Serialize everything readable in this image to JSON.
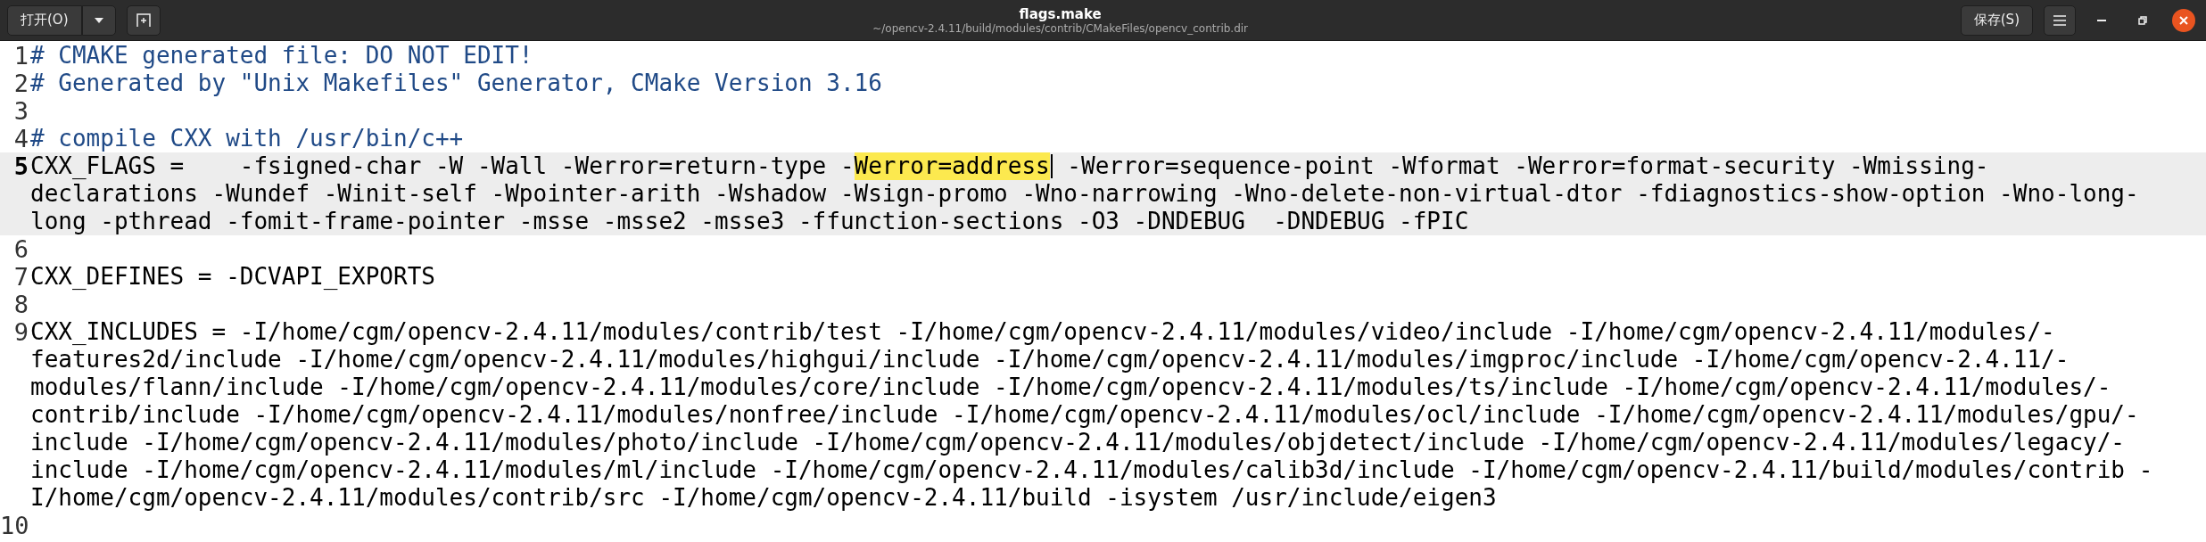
{
  "header": {
    "open_button": "打开(O)",
    "title": "flags.make",
    "subtitle": "~/opencv-2.4.11/build/modules/contrib/CMakeFiles/opencv_contrib.dir",
    "save_button": "保存(S)"
  },
  "lines": [
    {
      "number": "1",
      "kind": "comment",
      "current": false,
      "rows": [
        [
          {
            "text": "# CMAKE generated file: DO NOT EDIT!",
            "highlighted": false,
            "cursor": false
          }
        ]
      ]
    },
    {
      "number": "2",
      "kind": "comment",
      "current": false,
      "rows": [
        [
          {
            "text": "# Generated by \"Unix Makefiles\" Generator, CMake Version 3.16",
            "highlighted": false,
            "cursor": false
          }
        ]
      ]
    },
    {
      "number": "3",
      "current": false
    },
    {
      "number": "4",
      "kind": "comment",
      "current": false,
      "rows": [
        [
          {
            "text": "# compile CXX with /usr/bin/c++",
            "highlighted": false,
            "cursor": false
          }
        ]
      ]
    },
    {
      "number": "5",
      "kind": "plain",
      "current": true,
      "rows": [
        [
          {
            "text": "CXX_FLAGS =    -fsigned-char -W -Wall -Werror=return-type -",
            "highlighted": false,
            "cursor": false
          },
          {
            "text": "Werror=address",
            "highlighted": true,
            "cursor": true
          },
          {
            "text": " -Werror=sequence-point -Wformat -Werror=format-security -Wmissing-",
            "highlighted": false,
            "cursor": false
          }
        ],
        [
          {
            "text": "declarations -Wundef -Winit-self -Wpointer-arith -Wshadow -Wsign-promo -Wno-narrowing -Wno-delete-non-virtual-dtor -fdiagnostics-show-option -Wno-long-",
            "highlighted": false,
            "cursor": false
          }
        ],
        [
          {
            "text": "long -pthread -fomit-frame-pointer -msse -msse2 -msse3 -ffunction-sections -O3 -DNDEBUG  -DNDEBUG -fPIC",
            "highlighted": false,
            "cursor": false
          }
        ]
      ]
    },
    {
      "number": "6",
      "current": false
    },
    {
      "number": "7",
      "kind": "plain",
      "current": false,
      "rows": [
        [
          {
            "text": "CXX_DEFINES = -DCVAPI_EXPORTS",
            "highlighted": false,
            "cursor": false
          }
        ]
      ]
    },
    {
      "number": "8",
      "current": false
    },
    {
      "number": "9",
      "kind": "plain",
      "current": false,
      "rows": [
        [
          {
            "text": "CXX_INCLUDES = -I/home/cgm/opencv-2.4.11/modules/contrib/test -I/home/cgm/opencv-2.4.11/modules/video/include -I/home/cgm/opencv-2.4.11/modules/-",
            "highlighted": false,
            "cursor": false
          }
        ],
        [
          {
            "text": "features2d/include -I/home/cgm/opencv-2.4.11/modules/highgui/include -I/home/cgm/opencv-2.4.11/modules/imgproc/include -I/home/cgm/opencv-2.4.11/-",
            "highlighted": false,
            "cursor": false
          }
        ],
        [
          {
            "text": "modules/flann/include -I/home/cgm/opencv-2.4.11/modules/core/include -I/home/cgm/opencv-2.4.11/modules/ts/include -I/home/cgm/opencv-2.4.11/modules/-",
            "highlighted": false,
            "cursor": false
          }
        ],
        [
          {
            "text": "contrib/include -I/home/cgm/opencv-2.4.11/modules/nonfree/include -I/home/cgm/opencv-2.4.11/modules/ocl/include -I/home/cgm/opencv-2.4.11/modules/gpu/-",
            "highlighted": false,
            "cursor": false
          }
        ],
        [
          {
            "text": "include -I/home/cgm/opencv-2.4.11/modules/photo/include -I/home/cgm/opencv-2.4.11/modules/objdetect/include -I/home/cgm/opencv-2.4.11/modules/legacy/-",
            "highlighted": false,
            "cursor": false
          }
        ],
        [
          {
            "text": "include -I/home/cgm/opencv-2.4.11/modules/ml/include -I/home/cgm/opencv-2.4.11/modules/calib3d/include -I/home/cgm/opencv-2.4.11/build/modules/contrib -",
            "highlighted": false,
            "cursor": false
          }
        ],
        [
          {
            "text": "I/home/cgm/opencv-2.4.11/modules/contrib/src -I/home/cgm/opencv-2.4.11/build -isystem /usr/include/eigen3",
            "highlighted": false,
            "cursor": false
          }
        ]
      ]
    },
    {
      "number": "10",
      "current": false
    }
  ]
}
